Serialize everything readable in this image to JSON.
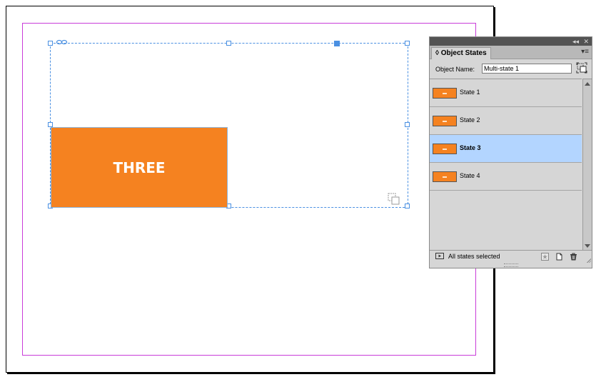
{
  "canvas": {
    "frame_text": "THREE",
    "accent_color": "#f58220",
    "selection_color": "#4a90e2",
    "margin_color": "#c93cd9"
  },
  "panel": {
    "title": "Object States",
    "object_name_label": "Object Name:",
    "object_name_value": "Multi-state 1",
    "states": [
      {
        "label": "State 1",
        "selected": false
      },
      {
        "label": "State 2",
        "selected": false
      },
      {
        "label": "State 3",
        "selected": true
      },
      {
        "label": "State 4",
        "selected": false
      }
    ],
    "footer_status": "All states selected",
    "collapse_glyph": "◂◂",
    "close_glyph": "✕",
    "menu_glyph": "▾≡",
    "tab_glyph": "◊",
    "icons": {
      "convert": "convert-to-mso-icon",
      "preview": "preview-spread-icon",
      "placeholder": "star-icon",
      "new_state": "new-state-icon",
      "delete": "trash-icon"
    }
  }
}
